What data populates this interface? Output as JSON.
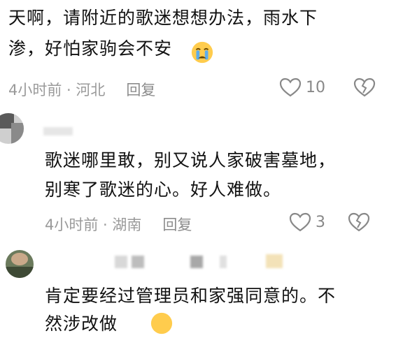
{
  "comment1": {
    "text_line1": "天啊，请附近的歌迷想想办法，雨水下",
    "text_line2": "渗，好怕家驹会不安",
    "emoji": "crying-face",
    "time_location": "4小时前 · 河北",
    "reply_label": "回复",
    "like_count": "10"
  },
  "comment2": {
    "text_line1": "歌迷哪里敢，别又说人家破害墓地，",
    "text_line2": "别寒了歌迷的心。好人难做。",
    "time_location": "4小时前 · 湖南",
    "reply_label": "回复",
    "like_count": "3"
  },
  "comment3": {
    "text_line1": "肯定要经过管理员和家强同意的。不",
    "text_line2": "然涉改做"
  },
  "colors": {
    "text": "#111111",
    "meta": "#9a9a9a",
    "icon": "#888888"
  }
}
